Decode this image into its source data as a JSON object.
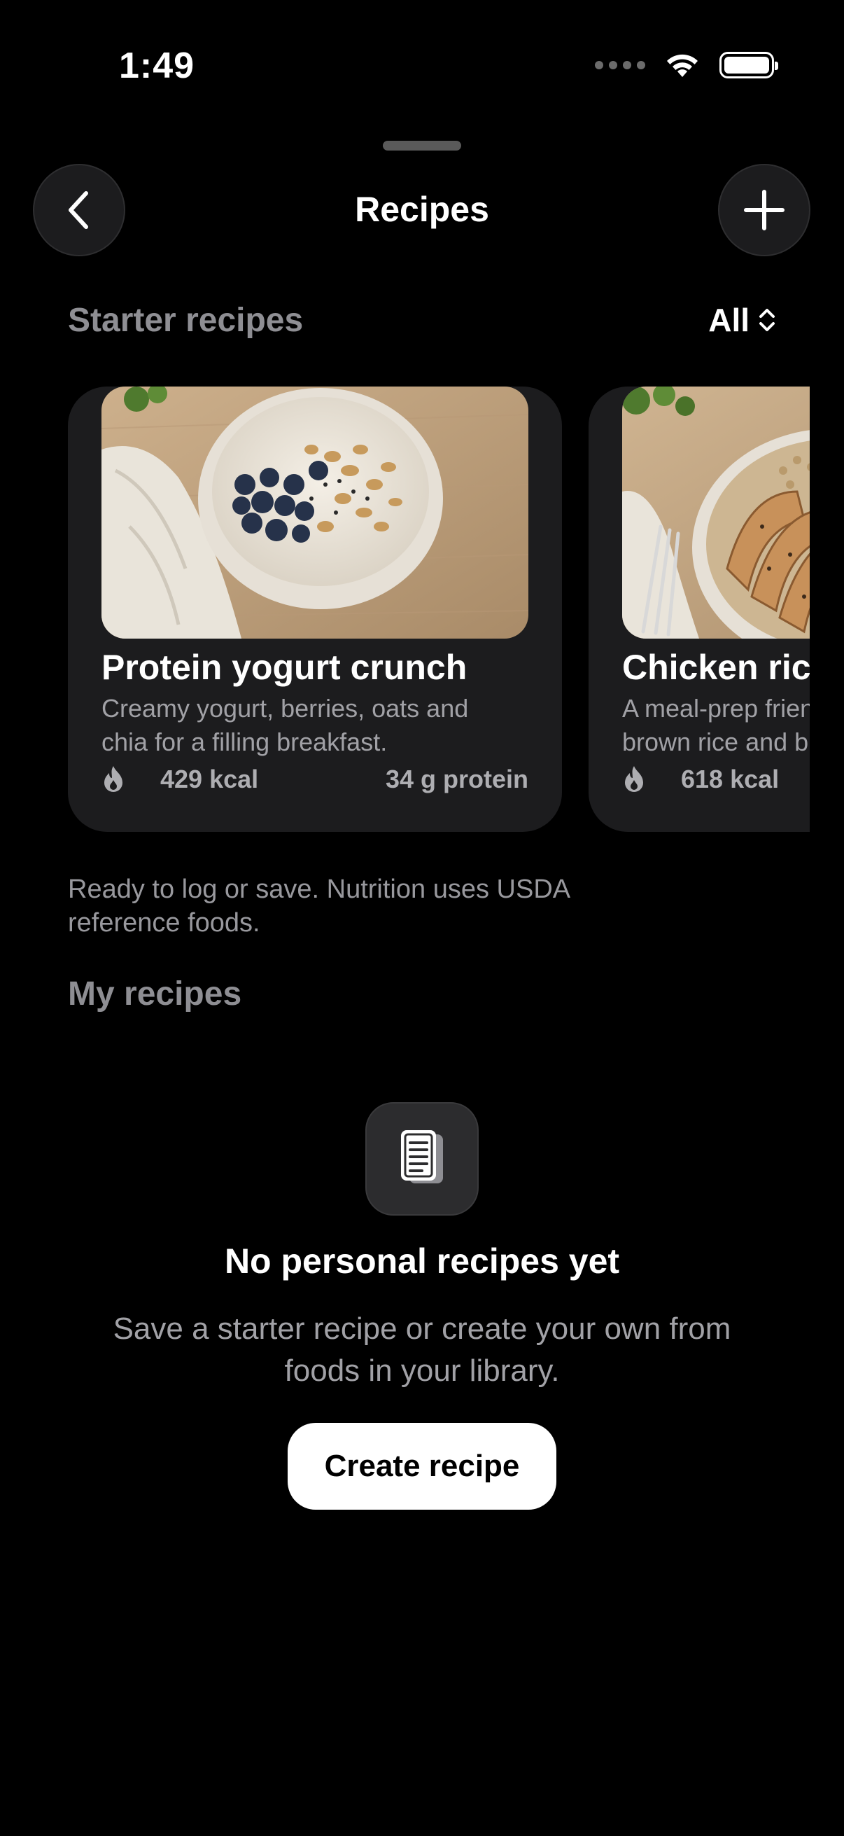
{
  "status_bar": {
    "time": "1:49"
  },
  "nav": {
    "title": "Recipes"
  },
  "starter": {
    "section_title": "Starter recipes",
    "filter_label": "All",
    "cards": [
      {
        "title": "Protein yogurt crunch",
        "desc_line1": "Creamy yogurt, berries, oats and",
        "desc_line2": "chia for a filling breakfast.",
        "kcal": "429 kcal",
        "protein": "34 g protein"
      },
      {
        "title": "Chicken rice",
        "desc_line1": "A meal-prep friendly bowl with",
        "desc_line2": "brown rice and broccoli.",
        "kcal": "618 kcal",
        "protein": ""
      }
    ],
    "note": "Ready to log or save. Nutrition uses USDA reference foods."
  },
  "my_recipes": {
    "section_title": "My recipes",
    "empty_title": "No personal recipes yet",
    "empty_desc": "Save a starter recipe or create your own from foods in your library.",
    "create_button": "Create recipe"
  }
}
